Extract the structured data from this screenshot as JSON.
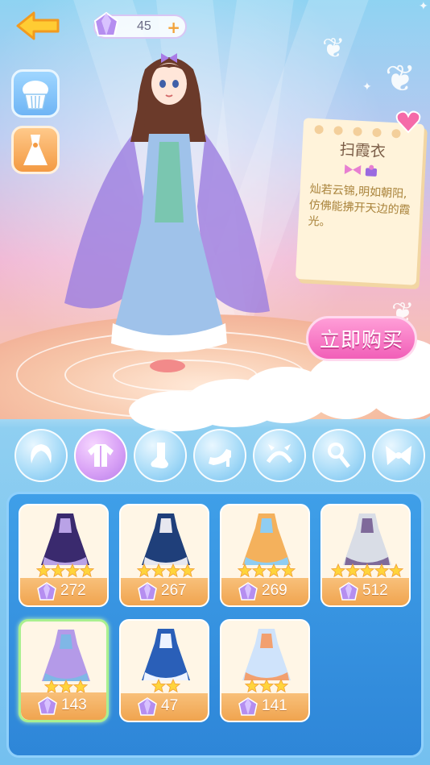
{
  "currency": {
    "gems": "45",
    "plus": "+"
  },
  "item_info": {
    "name": "扫霞衣",
    "description": "灿若云锦,明如朝阳,仿佛能拂开天边的霞光。"
  },
  "buy_button": {
    "label": "立即购买"
  },
  "categories": [
    {
      "id": "hair",
      "icon": "hair-icon"
    },
    {
      "id": "clothes",
      "icon": "jacket-icon",
      "active": true
    },
    {
      "id": "socks",
      "icon": "sock-icon"
    },
    {
      "id": "shoes",
      "icon": "high-heel-icon"
    },
    {
      "id": "headwear",
      "icon": "headband-icon"
    },
    {
      "id": "accessory",
      "icon": "wand-icon"
    },
    {
      "id": "wings",
      "icon": "bow-icon"
    }
  ],
  "items": [
    {
      "name": "dark-purple-dress",
      "stars": 4,
      "price": "272",
      "colors": [
        "#3a2a6e",
        "#b9a2e6"
      ]
    },
    {
      "name": "blue-uniform",
      "stars": 4,
      "price": "267",
      "colors": [
        "#1f3f7a",
        "#e7e7ef"
      ]
    },
    {
      "name": "orange-fairy-dress",
      "stars": 4,
      "price": "269",
      "colors": [
        "#f4b15c",
        "#8fcdf2"
      ]
    },
    {
      "name": "white-feather-robe",
      "stars": 5,
      "price": "512",
      "colors": [
        "#d9dde6",
        "#7f6a9a"
      ]
    },
    {
      "name": "lavender-hanfu",
      "stars": 3,
      "price": "143",
      "colors": [
        "#b49ae8",
        "#7fb7e6"
      ],
      "selected": true
    },
    {
      "name": "blue-white-set",
      "stars": 2,
      "price": "47",
      "colors": [
        "#2a5fb8",
        "#eef4ff"
      ]
    },
    {
      "name": "sailor-dress",
      "stars": 3,
      "price": "141",
      "colors": [
        "#cfe3fb",
        "#f2a06f"
      ]
    }
  ],
  "colors": {
    "accent_pink": "#f15fb8",
    "panel_blue": "#2e86d8",
    "price_orange": "#f0a44f",
    "star_yellow": "#ffd43b"
  }
}
